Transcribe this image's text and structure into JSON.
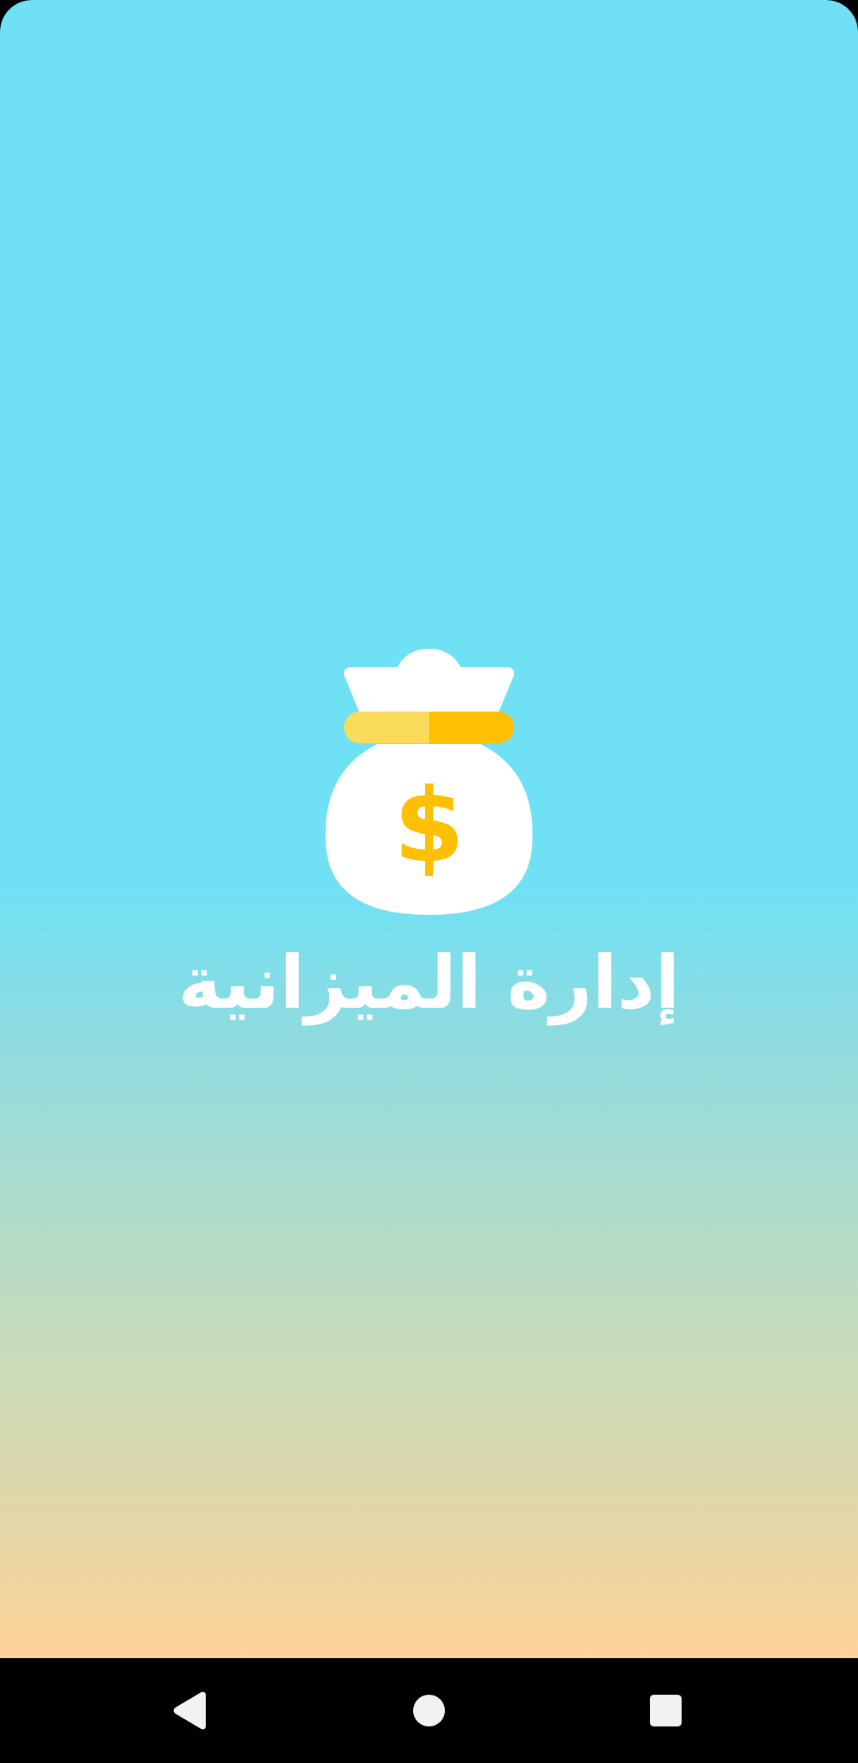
{
  "app": {
    "title": "إدارة الميزانية",
    "logo_icon": "money-bag-icon"
  },
  "colors": {
    "gradient_top": "#70e1f4",
    "gradient_bottom": "#fdd397",
    "bag": "#ffffff",
    "tie_light": "#fbdb5b",
    "tie_dark": "#fec000",
    "title_text": "#ffffff",
    "nav_bar": "#000000",
    "nav_icon": "#f2f2f2"
  },
  "navigation_bar": {
    "back_icon": "triangle-back-icon",
    "home_icon": "circle-home-icon",
    "recents_icon": "square-recents-icon"
  }
}
